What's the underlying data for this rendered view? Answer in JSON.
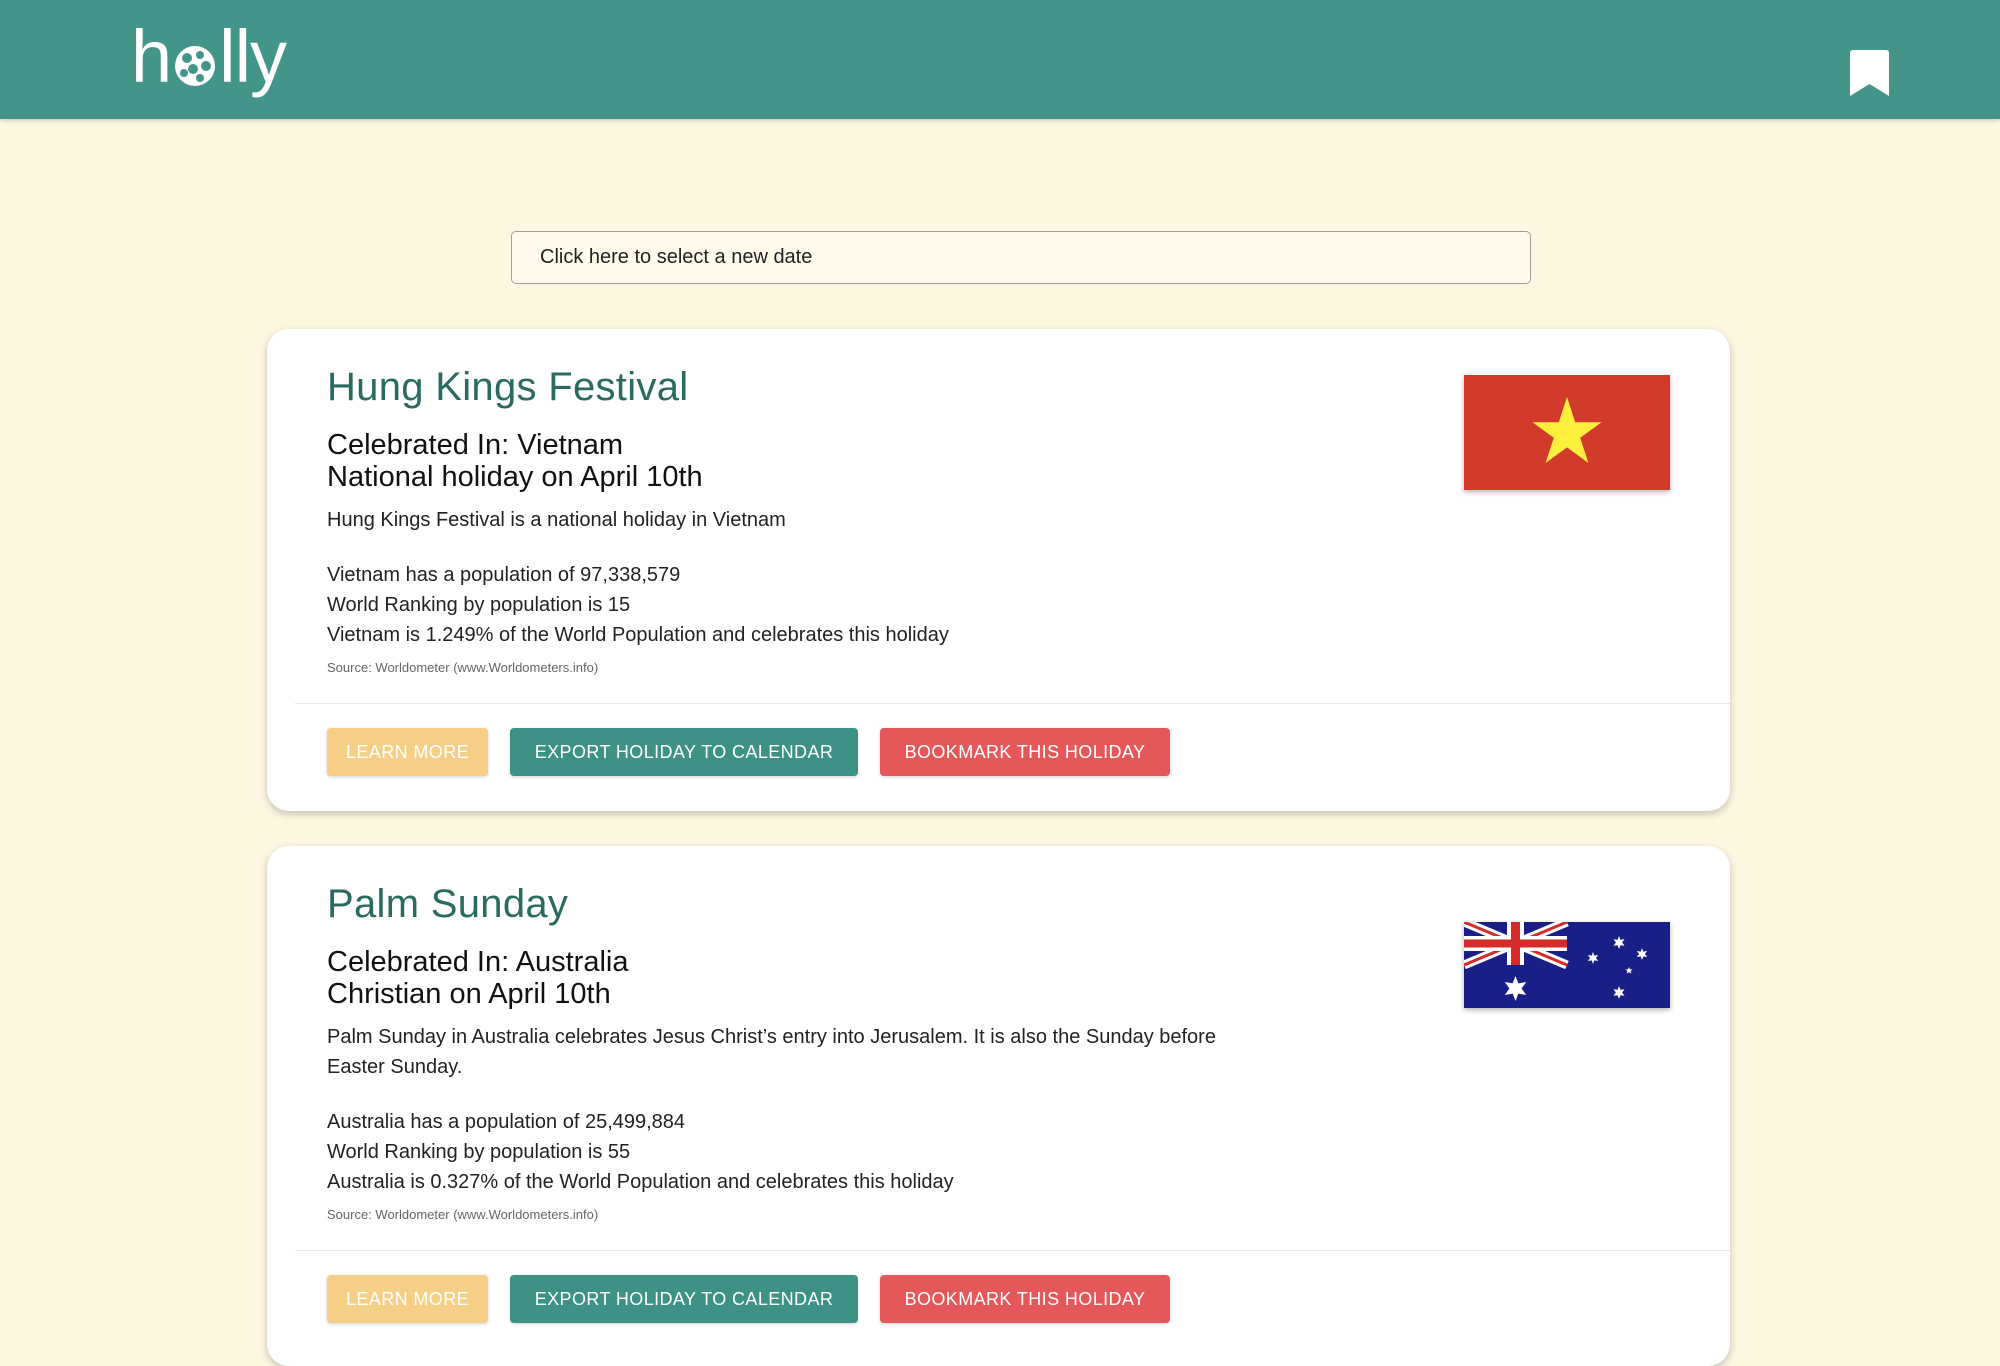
{
  "header": {
    "logo_text_pre": "h",
    "logo_text_post": "lly",
    "logo_icon": "globe-icon",
    "bookmark_icon": "bookmark-icon",
    "background_color": "#43958a"
  },
  "date_picker": {
    "placeholder": "Click here to select a new date"
  },
  "holidays": [
    {
      "title": "Hung Kings Festival",
      "celebrated_in": "Celebrated In: Vietnam",
      "type_date": "National holiday on April 10th",
      "description": "Hung Kings Festival is a national holiday in Vietnam",
      "population": "Vietnam has a population of 97,338,579",
      "ranking": "World Ranking by population is 15",
      "share": "Vietnam is 1.249% of the World Population and celebrates this holiday",
      "source": "Source: Worldometer (www.Worldometers.info)",
      "flag": "vietnam-flag"
    },
    {
      "title": "Palm Sunday",
      "celebrated_in": "Celebrated In: Australia",
      "type_date": "Christian on April 10th",
      "description": "Palm Sunday in Australia celebrates Jesus Christ’s entry into Jerusalem. It is also the Sunday before Easter Sunday.",
      "population": "Australia has a population of 25,499,884",
      "ranking": "World Ranking by population is 55",
      "share": "Australia is 0.327% of the World Population and celebrates this holiday",
      "source": "Source: Worldometer (www.Worldometers.info)",
      "flag": "australia-flag"
    }
  ],
  "actions": {
    "learn_more": "LEARN MORE",
    "export": "EXPORT HOLIDAY TO CALENDAR",
    "bookmark": "BOOKMARK THIS HOLIDAY"
  },
  "colors": {
    "page_background": "#fdf6e1",
    "title": "#2a6b5f",
    "learn_more": "#f6cf87",
    "export": "#3e9285",
    "bookmark": "#e5585a"
  }
}
